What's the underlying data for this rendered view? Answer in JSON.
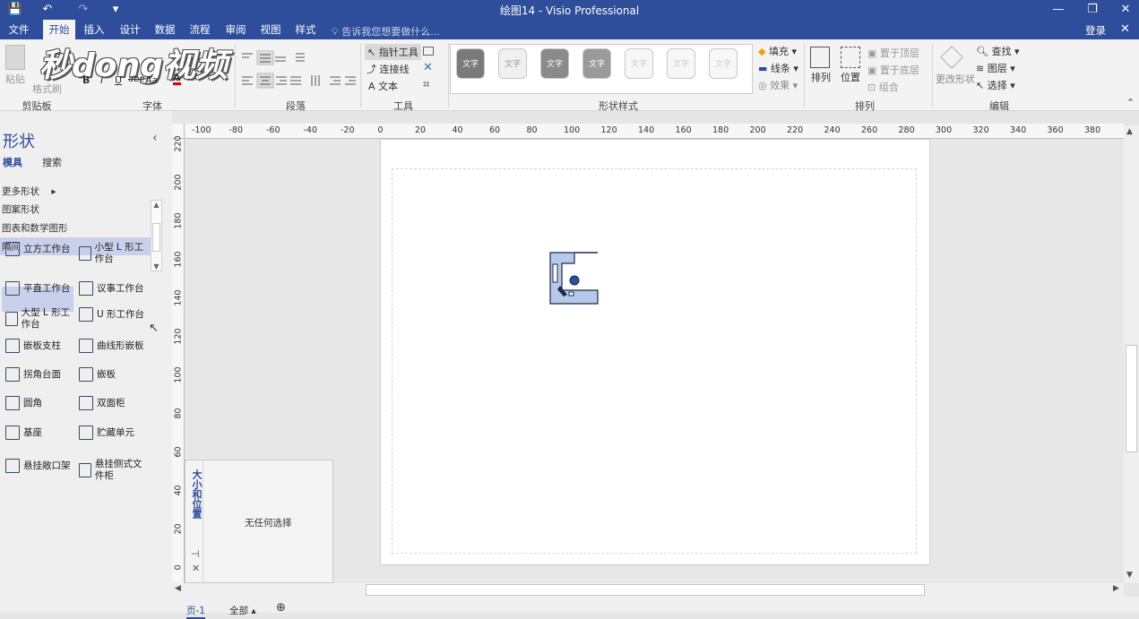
{
  "window": {
    "title": "绘图14 - Visio Professional",
    "login": "登录",
    "minimize_icon": "—",
    "restore_icon": "❐",
    "close_icon": "✕"
  },
  "qat": {
    "save_icon": "💾",
    "undo_icon": "↶",
    "redo_icon": "↷",
    "more_icon": "▾"
  },
  "menu": {
    "tabs": [
      "文件",
      "开始",
      "插入",
      "设计",
      "数据",
      "流程",
      "审阅",
      "视图",
      "样式"
    ],
    "active": "开始",
    "tell_me": "告诉我您想要做什么..."
  },
  "ribbon": {
    "clipboard": {
      "paste": "粘贴",
      "format_painter": "格式刷",
      "label": "剪贴板"
    },
    "font": {
      "label": "字体",
      "bold": "B",
      "italic": "I",
      "underline": "U",
      "strike": "abc",
      "case": "Aa",
      "color": "A"
    },
    "paragraph": {
      "label": "段落"
    },
    "tools": {
      "label": "工具",
      "pointer": "指针工具",
      "connector": "连接线",
      "text": "文本"
    },
    "shape_styles": {
      "label": "形状样式",
      "thumb_text": "文字",
      "thumbs": [
        {
          "bg": "#7a7a7a",
          "color": "#ffffff"
        },
        {
          "bg": "#f0f0f0",
          "color": "#999999"
        },
        {
          "bg": "#8a8a8a",
          "color": "#ffffff"
        },
        {
          "bg": "#9a9a9a",
          "color": "#ffffff"
        },
        {
          "bg": "#f7f7f7",
          "color": "#cccccc"
        },
        {
          "bg": "#f7f7f7",
          "color": "#cccccc"
        },
        {
          "bg": "#f7f7f7",
          "color": "#cccccc"
        }
      ]
    },
    "fill": "填充",
    "line": "线条",
    "effect": "效果",
    "arrange": {
      "label": "排列",
      "arrange_btn": "排列",
      "position_btn": "位置",
      "bring_front": "置于顶层",
      "send_back": "置于底层",
      "group": "组合"
    },
    "change_shape": "更改形状",
    "editing": {
      "label": "编辑",
      "find": "查找",
      "layers": "图层",
      "select": "选择"
    }
  },
  "watermark": "秒dong视频",
  "shapes_panel": {
    "title": "形状",
    "tab_stencils": "模具",
    "tab_search": "搜索",
    "collapse_icon": "‹",
    "stencils": [
      "更多形状",
      "图案形状",
      "图表和数学图形",
      "隔间"
    ],
    "selected_stencil": "隔间",
    "items": [
      {
        "label": "立方工作台",
        "selected": true
      },
      {
        "label": "小型 L 形工作台"
      },
      {
        "label": "平直工作台"
      },
      {
        "label": "议事工作台"
      },
      {
        "label": "大型 L 形工作台"
      },
      {
        "label": "U 形工作台"
      },
      {
        "label": "嵌板支柱"
      },
      {
        "label": "曲线形嵌板"
      },
      {
        "label": "拐角台面"
      },
      {
        "label": "嵌板"
      },
      {
        "label": "圆角"
      },
      {
        "label": "双面柜"
      },
      {
        "label": "基座"
      },
      {
        "label": "贮藏单元"
      },
      {
        "label": "悬挂敞口架"
      },
      {
        "label": "悬挂侧式文件柜"
      }
    ]
  },
  "size_panel": {
    "title": "大小和位置",
    "empty": "无任何选择",
    "pin_icon": "⊣",
    "close_icon": "✕"
  },
  "ruler_top": [
    "-100",
    "-80",
    "-60",
    "-40",
    "-20",
    "0",
    "20",
    "40",
    "60",
    "80",
    "100",
    "120",
    "140",
    "160",
    "180",
    "200",
    "220",
    "240",
    "260",
    "280",
    "300",
    "320",
    "340",
    "360",
    "380"
  ],
  "ruler_left": [
    "220",
    "200",
    "180",
    "160",
    "140",
    "120",
    "100",
    "80",
    "60",
    "40",
    "20",
    "0"
  ],
  "pages": {
    "current": "页-1",
    "all": "全部",
    "add_icon": "⊕"
  }
}
